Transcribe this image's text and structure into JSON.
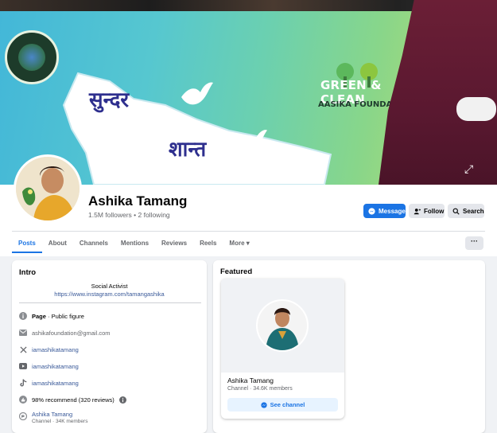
{
  "cover": {
    "banner_logo_text": "GREEN & CLEAN",
    "banner_title": "GREEN & CLEAN",
    "banner_subtitle": "AASIKA FOUNDATION",
    "banner_text_line1": "सुन्दर",
    "banner_text_line2": "शान्त"
  },
  "profile": {
    "name": "Ashika Tamang",
    "stats": "1.5M followers • 2 following"
  },
  "actions": {
    "message": "Message",
    "follow": "Follow",
    "search": "Search"
  },
  "tabs": [
    {
      "label": "Posts",
      "active": true
    },
    {
      "label": "About"
    },
    {
      "label": "Channels"
    },
    {
      "label": "Mentions"
    },
    {
      "label": "Reviews"
    },
    {
      "label": "Reels"
    },
    {
      "label": "More ▾"
    }
  ],
  "more_menu": "···",
  "intro": {
    "title": "Intro",
    "bio": "Social Activist",
    "bio_link": "https://www.instagram.com/tamangashika",
    "items": [
      {
        "icon": "info-icon",
        "bold": "Page",
        "text": " · Public figure"
      },
      {
        "icon": "mail-icon",
        "text": "ashikafoundation@gmail.com"
      },
      {
        "icon": "x-icon",
        "link": "iamashikatamang"
      },
      {
        "icon": "youtube-icon",
        "link": "iamashikatamang"
      },
      {
        "icon": "tiktok-icon",
        "link": "iamashikatamang"
      },
      {
        "icon": "recommend-icon",
        "text": "98% recommend (320 reviews)"
      },
      {
        "icon": "channel-icon",
        "link": "Ashika Tamang",
        "sub": "Channel · 34K members"
      }
    ]
  },
  "featured": {
    "title": "Featured",
    "card": {
      "name": "Ashika Tamang",
      "sub": "Channel · 34.6K members",
      "button": "See channel"
    }
  },
  "colors": {
    "accent": "#1b74e4",
    "link": "#385898",
    "muted": "#65676b"
  }
}
